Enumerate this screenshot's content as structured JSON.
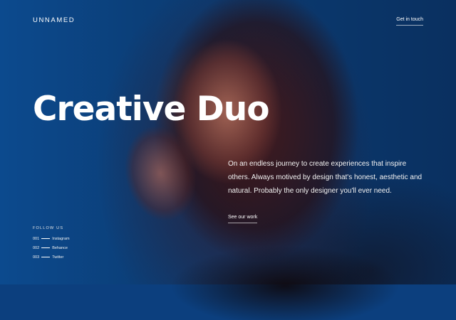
{
  "header": {
    "logo": "UNNAMED",
    "contact_link": "Get in touch"
  },
  "hero": {
    "title": "Creative Duo",
    "description": "On an endless journey to create experiences that inspire others. Always motived by design that's honest, aesthetic and natural. Probably the only designer you'll ever need.",
    "cta": "See our work"
  },
  "social": {
    "label": "FOLLOW US",
    "items": [
      {
        "number": "001",
        "name": "Instagram"
      },
      {
        "number": "002",
        "name": "Behance"
      },
      {
        "number": "003",
        "name": "Twitter"
      }
    ]
  },
  "colors": {
    "background": "#0c3f7e",
    "text": "#ffffff"
  }
}
